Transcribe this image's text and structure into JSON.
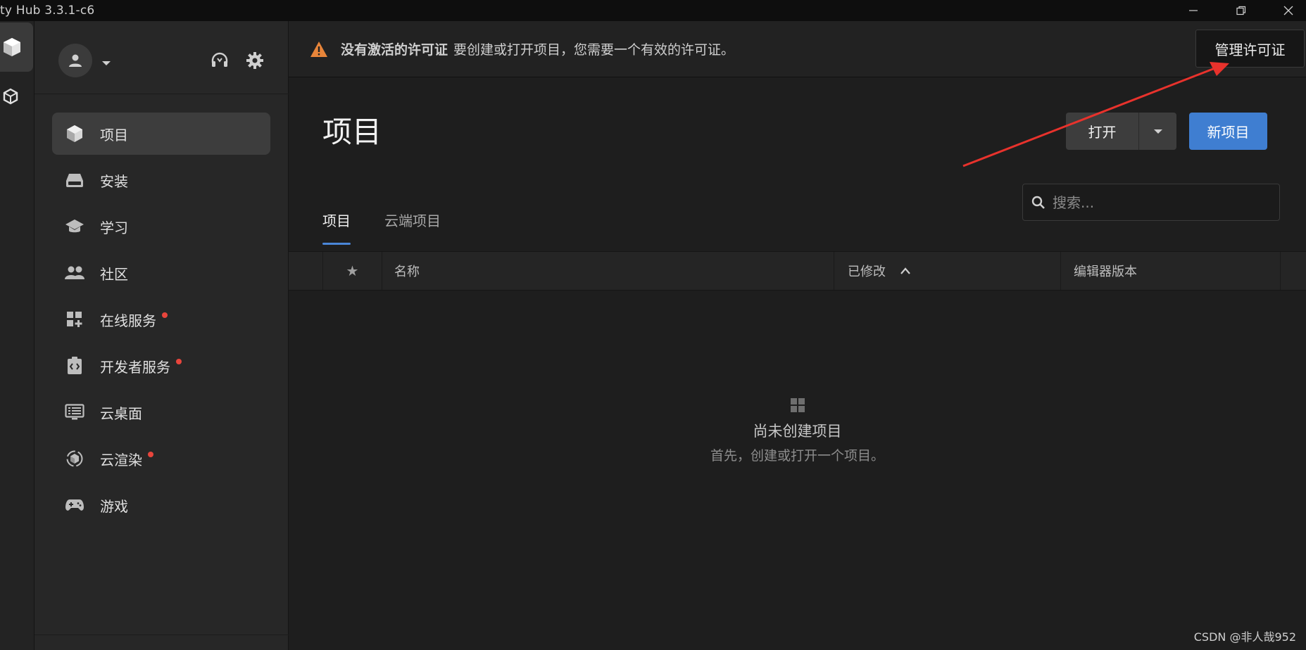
{
  "window": {
    "title": "ty Hub 3.3.1-c6"
  },
  "sidebar": {
    "items": [
      {
        "label": "项目",
        "icon": "cube-icon",
        "active": true,
        "dot": false
      },
      {
        "label": "安装",
        "icon": "drive-icon",
        "active": false,
        "dot": false
      },
      {
        "label": "学习",
        "icon": "graduation-cap-icon",
        "active": false,
        "dot": false
      },
      {
        "label": "社区",
        "icon": "people-icon",
        "active": false,
        "dot": false
      },
      {
        "label": "在线服务",
        "icon": "widgets-add-icon",
        "active": false,
        "dot": true
      },
      {
        "label": "开发者服务",
        "icon": "code-badge-icon",
        "active": false,
        "dot": true
      },
      {
        "label": "云桌面",
        "icon": "monitor-list-icon",
        "active": false,
        "dot": false
      },
      {
        "label": "云渲染",
        "icon": "cloud-render-icon",
        "active": false,
        "dot": true
      },
      {
        "label": "游戏",
        "icon": "gamepad-icon",
        "active": false,
        "dot": false
      }
    ]
  },
  "banner": {
    "title": "没有激活的许可证",
    "text": "要创建或打开项目，您需要一个有效的许可证。",
    "manage_button": "管理许可证"
  },
  "main": {
    "title": "项目",
    "open_button": "打开",
    "new_button": "新项目",
    "tabs": [
      {
        "label": "项目",
        "active": true
      },
      {
        "label": "云端项目",
        "active": false
      }
    ],
    "search": {
      "placeholder": "搜索..."
    },
    "table": {
      "star": "★",
      "columns": {
        "name": "名称",
        "modified": "已修改",
        "editor": "编辑器版本"
      }
    },
    "empty": {
      "title": "尚未创建项目",
      "subtitle": "首先，创建或打开一个项目。"
    }
  },
  "watermark": "CSDN @非人哉952",
  "colors": {
    "accent": "#3f7ed1",
    "warning": "#e8853a",
    "dot": "#e8453c",
    "annotation_arrow": "#e8322c"
  }
}
